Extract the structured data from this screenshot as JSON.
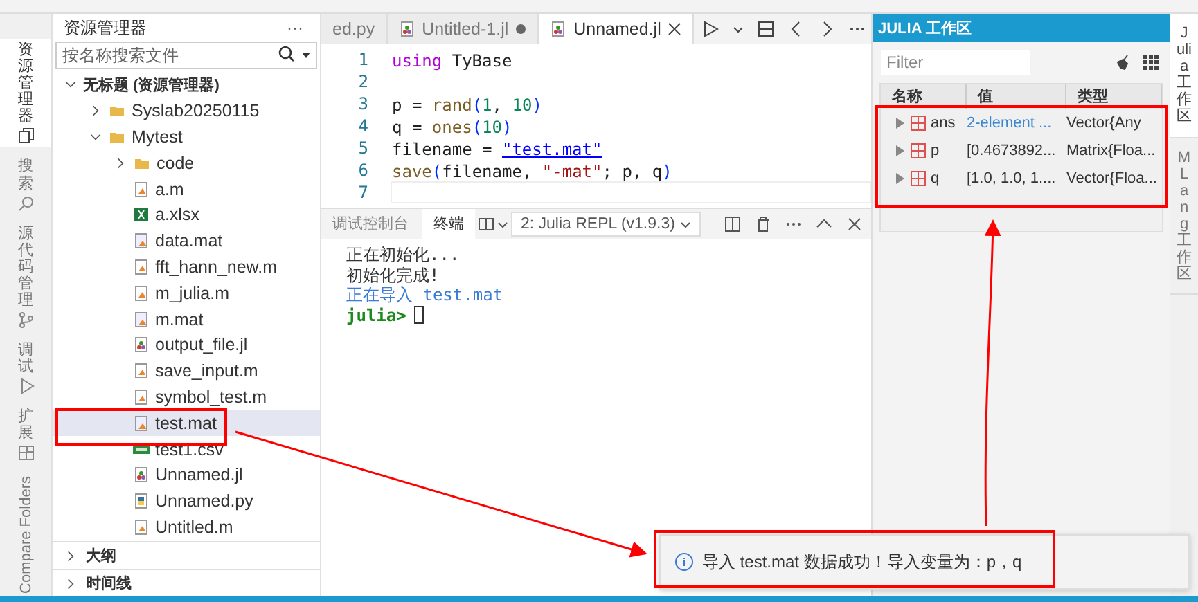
{
  "activity_bar": [
    {
      "label": "资源管理器",
      "kind": "files",
      "selected": true
    },
    {
      "label": "搜索",
      "kind": "search",
      "selected": false
    },
    {
      "label": "源代码管理",
      "kind": "branch",
      "selected": false
    },
    {
      "label": "调试",
      "kind": "debug",
      "selected": false
    },
    {
      "label": "扩展",
      "kind": "extensions",
      "selected": false
    },
    {
      "label": "Compare Folders",
      "kind": "compare",
      "selected": false
    }
  ],
  "explorer": {
    "title": "资源管理器",
    "more": "···",
    "search": {
      "placeholder": "按名称搜索文件"
    },
    "tree": [
      {
        "label": "无标题 (资源管理器)",
        "kind": "root",
        "expanded": true,
        "selected": false,
        "children": [
          {
            "label": "Syslab20250115",
            "kind": "folder",
            "expanded": false,
            "selected": false
          },
          {
            "label": "Mytest",
            "kind": "folder",
            "expanded": true,
            "selected": false,
            "children": [
              {
                "label": "code",
                "kind": "folder",
                "expanded": false,
                "selected": false
              },
              {
                "label": "a.m",
                "kind": "m",
                "selected": false
              },
              {
                "label": "a.xlsx",
                "kind": "xlsx",
                "selected": false
              },
              {
                "label": "data.mat",
                "kind": "mat",
                "selected": false
              },
              {
                "label": "fft_hann_new.m",
                "kind": "m",
                "selected": false
              },
              {
                "label": "m_julia.m",
                "kind": "m",
                "selected": false
              },
              {
                "label": "m.mat",
                "kind": "mat",
                "selected": false
              },
              {
                "label": "output_file.jl",
                "kind": "jl",
                "selected": false
              },
              {
                "label": "save_input.m",
                "kind": "m",
                "selected": false
              },
              {
                "label": "symbol_test.m",
                "kind": "m",
                "selected": false
              },
              {
                "label": "test.mat",
                "kind": "mat",
                "selected": true
              },
              {
                "label": "test1.csv",
                "kind": "csv",
                "selected": false
              },
              {
                "label": "Unnamed.jl",
                "kind": "jl",
                "selected": false
              },
              {
                "label": "Unnamed.py",
                "kind": "py",
                "selected": false
              },
              {
                "label": "Untitled.m",
                "kind": "m",
                "selected": false
              }
            ]
          }
        ]
      }
    ],
    "sections": [
      {
        "label": "大纲",
        "expanded": false
      },
      {
        "label": "时间线",
        "expanded": false
      }
    ]
  },
  "editor": {
    "tabs": [
      {
        "label": "ed.py",
        "kind": "none",
        "selected": false,
        "modified": false
      },
      {
        "label": "Untitled-1.jl",
        "kind": "jl",
        "selected": false,
        "modified": true
      },
      {
        "label": "Unnamed.jl",
        "kind": "jl",
        "selected": true,
        "modified": false
      }
    ],
    "lines": [
      {
        "number": "1",
        "tokens": [
          {
            "text": "using",
            "kind": "keyword"
          },
          {
            "text": " TyBase",
            "kind": "plain"
          }
        ]
      },
      {
        "number": "2"
      },
      {
        "number": "3",
        "tokens": [
          {
            "text": "p = ",
            "kind": "plain"
          },
          {
            "text": "rand",
            "kind": "function"
          },
          {
            "text": "(",
            "kind": "paren"
          },
          {
            "text": "1",
            "kind": "number"
          },
          {
            "text": ", ",
            "kind": "plain"
          },
          {
            "text": "10",
            "kind": "number"
          },
          {
            "text": ")",
            "kind": "paren"
          }
        ]
      },
      {
        "number": "4",
        "tokens": [
          {
            "text": "q = ",
            "kind": "plain"
          },
          {
            "text": "ones",
            "kind": "function"
          },
          {
            "text": "(",
            "kind": "paren"
          },
          {
            "text": "10",
            "kind": "number"
          },
          {
            "text": ")",
            "kind": "paren"
          }
        ]
      },
      {
        "number": "5",
        "tokens": [
          {
            "text": "filename = ",
            "kind": "plain"
          },
          {
            "text": "\"test.mat\"",
            "kind": "link"
          }
        ]
      },
      {
        "number": "6",
        "tokens": [
          {
            "text": "save",
            "kind": "function"
          },
          {
            "text": "(",
            "kind": "paren"
          },
          {
            "text": "filename, ",
            "kind": "plain"
          },
          {
            "text": "\"-mat\"",
            "kind": "string"
          },
          {
            "text": "; p, q",
            "kind": "plain"
          },
          {
            "text": ")",
            "kind": "paren"
          }
        ]
      },
      {
        "number": "7",
        "current": true
      }
    ]
  },
  "panel": {
    "tabs": [
      {
        "label": "调试控制台",
        "selected": false
      },
      {
        "label": "终端",
        "selected": true
      }
    ],
    "terminal_select": {
      "value": "2: Julia REPL (v1.9.3)"
    },
    "terminal": [
      {
        "text": "正在初始化...",
        "kind": "plain"
      },
      {
        "text": "初始化完成!",
        "kind": "plain"
      },
      {
        "text": "正在导入 test.mat",
        "kind": "info"
      },
      {
        "text": "julia>",
        "kind": "prompt"
      }
    ]
  },
  "workspace": {
    "title": "JULIA 工作区",
    "filter": {
      "placeholder": "Filter"
    },
    "columns": [
      "名称",
      "值",
      "类型"
    ],
    "rows": [
      {
        "name": "ans",
        "value": "2-element ...",
        "type": "Vector{Any",
        "link": true
      },
      {
        "name": "p",
        "value": "[0.4673892...",
        "type": "Matrix{Floa...",
        "link": false
      },
      {
        "name": "q",
        "value": "[1.0, 1.0, 1....",
        "type": "Vector{Floa...",
        "link": false
      }
    ]
  },
  "side_tabs": [
    {
      "label": "Julia 工作区",
      "selected": true
    },
    {
      "label": "MLang 工作区",
      "selected": false
    }
  ],
  "notification": {
    "message": "导入 test.mat 数据成功！导入变量为：p，q"
  }
}
